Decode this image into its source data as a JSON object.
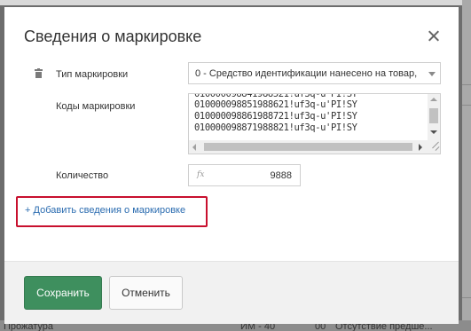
{
  "dialog": {
    "title": "Сведения о маркировке"
  },
  "form": {
    "marking_type": {
      "label": "Тип маркировки",
      "value": "0 - Средство идентификации нанесено на товар,"
    },
    "marking_codes": {
      "label": "Коды маркировки",
      "lines": [
        "010000098851988621!uf3q-u'PI!SY",
        "010000098861988721!uf3q-u'PI!SY",
        "010000098871988821!uf3q-u'PI!SY"
      ]
    },
    "quantity": {
      "label": "Количество",
      "value": "9888"
    },
    "add_link": "Добавить сведения о маркировке"
  },
  "footer": {
    "save_label": "Сохранить",
    "cancel_label": "Отменить"
  },
  "background": {
    "bottom_texts": [
      "Прожатура",
      "ИМ - 40",
      "00",
      "Отсутствие предше..."
    ]
  },
  "icons": {
    "close": "close-icon",
    "trash": "trash-icon",
    "fx": "fx-icon",
    "plus": "plus-icon"
  },
  "colors": {
    "save_button": "#3e8f5e",
    "link": "#2b6cb0",
    "highlight": "#c8102e"
  }
}
